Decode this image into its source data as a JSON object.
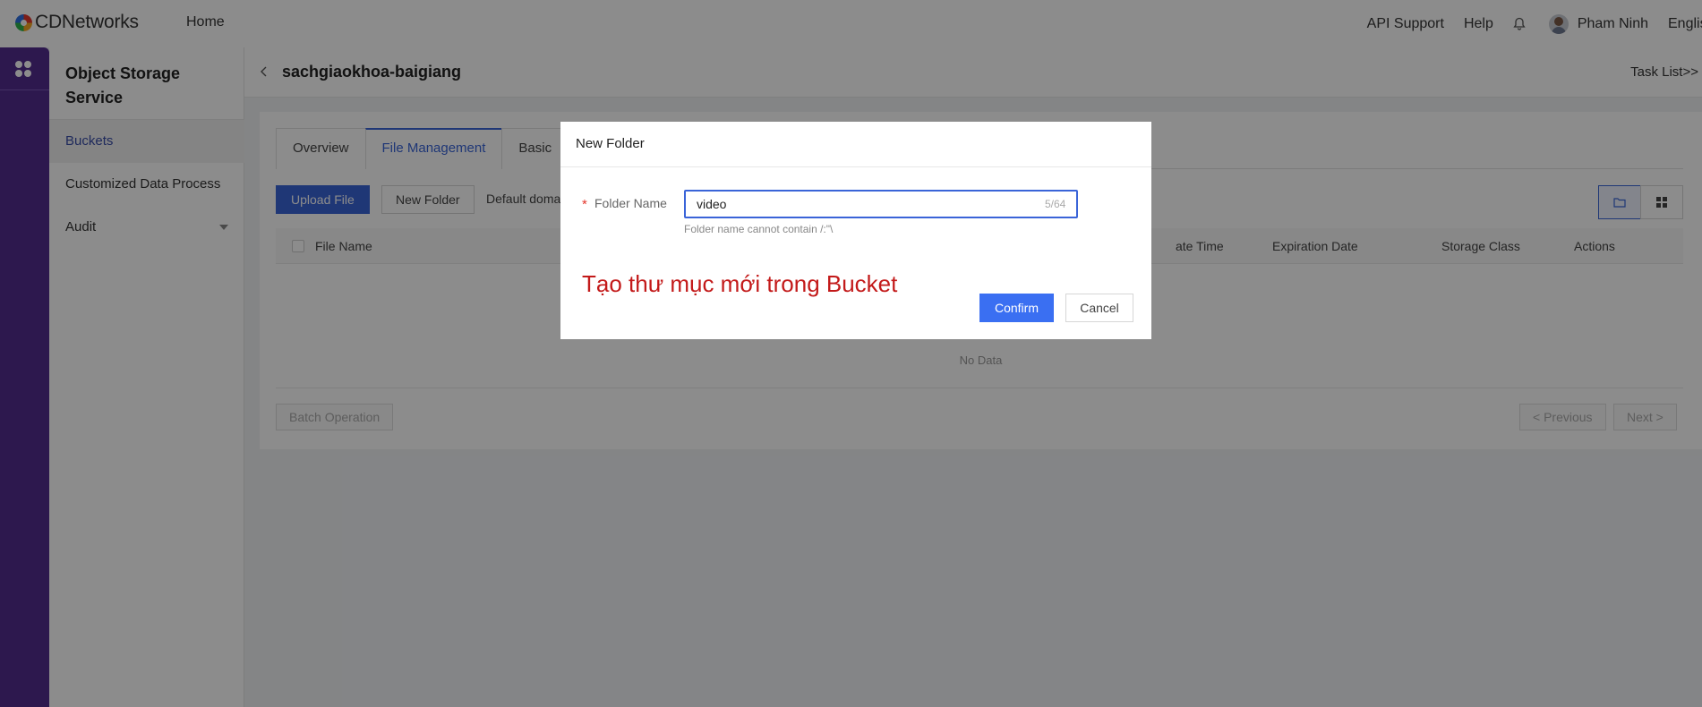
{
  "topbar": {
    "brand": "CDNetworks",
    "nav_home": "Home",
    "api_support": "API Support",
    "help": "Help",
    "user_name": "Pham Ninh",
    "language": "English",
    "bell_icon": "bell-icon"
  },
  "sidebar": {
    "title": "Object Storage Service",
    "items": [
      {
        "label": "Buckets",
        "active": true
      },
      {
        "label": "Customized Data Process",
        "active": false
      },
      {
        "label": "Audit",
        "active": false
      }
    ]
  },
  "header": {
    "bucket_name": "sachgiaokhoa-baigiang",
    "task_list": "Task List>>"
  },
  "tabs": [
    "Overview",
    "File Management",
    "Basic"
  ],
  "toolbar": {
    "upload_file": "Upload File",
    "new_folder": "New Folder",
    "default_domain": "Default doma"
  },
  "table": {
    "columns": [
      "File Name",
      "ate Time",
      "Expiration Date",
      "Storage Class",
      "Actions"
    ],
    "empty_text": "No Data",
    "batch_operation": "Batch Operation",
    "previous": "< Previous",
    "next": "Next >"
  },
  "modal": {
    "title": "New Folder",
    "field_label": "Folder Name",
    "required_mark": "*",
    "input_value": "video",
    "counter": "5/64",
    "hint": "Folder name cannot contain /:\"\\",
    "annotation": "Tạo thư mục mới trong Bucket",
    "confirm": "Confirm",
    "cancel": "Cancel"
  },
  "colors": {
    "rail": "#532c8f",
    "primary": "#3a64d8",
    "confirm": "#3a6ff2",
    "annotation": "#c31a1a"
  }
}
